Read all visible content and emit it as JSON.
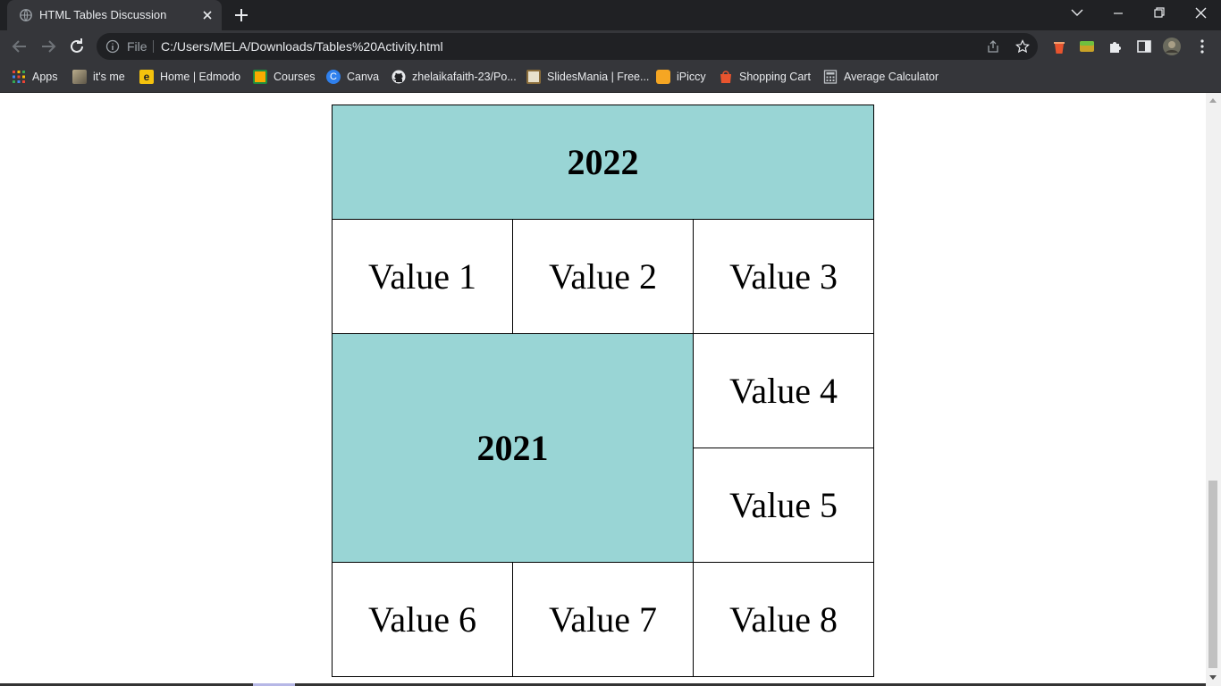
{
  "browser": {
    "tab_title": "HTML Tables Discussion",
    "address_prefix": "File",
    "url": "C:/Users/MELA/Downloads/Tables%20Activity.html"
  },
  "bookmarks": [
    {
      "label": "Apps",
      "icon": "apps-grid-icon",
      "color": "#ea4335"
    },
    {
      "label": "it's me",
      "icon": "image-thumbnail-icon",
      "color": "#8a7f6a"
    },
    {
      "label": "Home | Edmodo",
      "icon": "edmodo-icon",
      "color": "#f4c20d"
    },
    {
      "label": "Courses",
      "icon": "classroom-icon",
      "color": "#f9ab00"
    },
    {
      "label": "Canva",
      "icon": "canva-icon",
      "color": "#2f80ed"
    },
    {
      "label": "zhelaikafaith-23/Po...",
      "icon": "github-icon",
      "color": "#e8eaed"
    },
    {
      "label": "SlidesMania | Free...",
      "icon": "slidesmania-icon",
      "color": "#b7a46a"
    },
    {
      "label": "iPiccy",
      "icon": "ipiccy-icon",
      "color": "#f5a623"
    },
    {
      "label": "Shopping Cart",
      "icon": "shopping-bag-icon",
      "color": "#e8542e"
    },
    {
      "label": "Average Calculator",
      "icon": "calculator-icon",
      "color": "#9aa0a6"
    }
  ],
  "table": {
    "header_2022": "2022",
    "header_2021": "2021",
    "values": [
      "Value 1",
      "Value 2",
      "Value 3",
      "Value 4",
      "Value 5",
      "Value 6",
      "Value 7",
      "Value 8"
    ],
    "accent_color": "#99d5d5"
  }
}
